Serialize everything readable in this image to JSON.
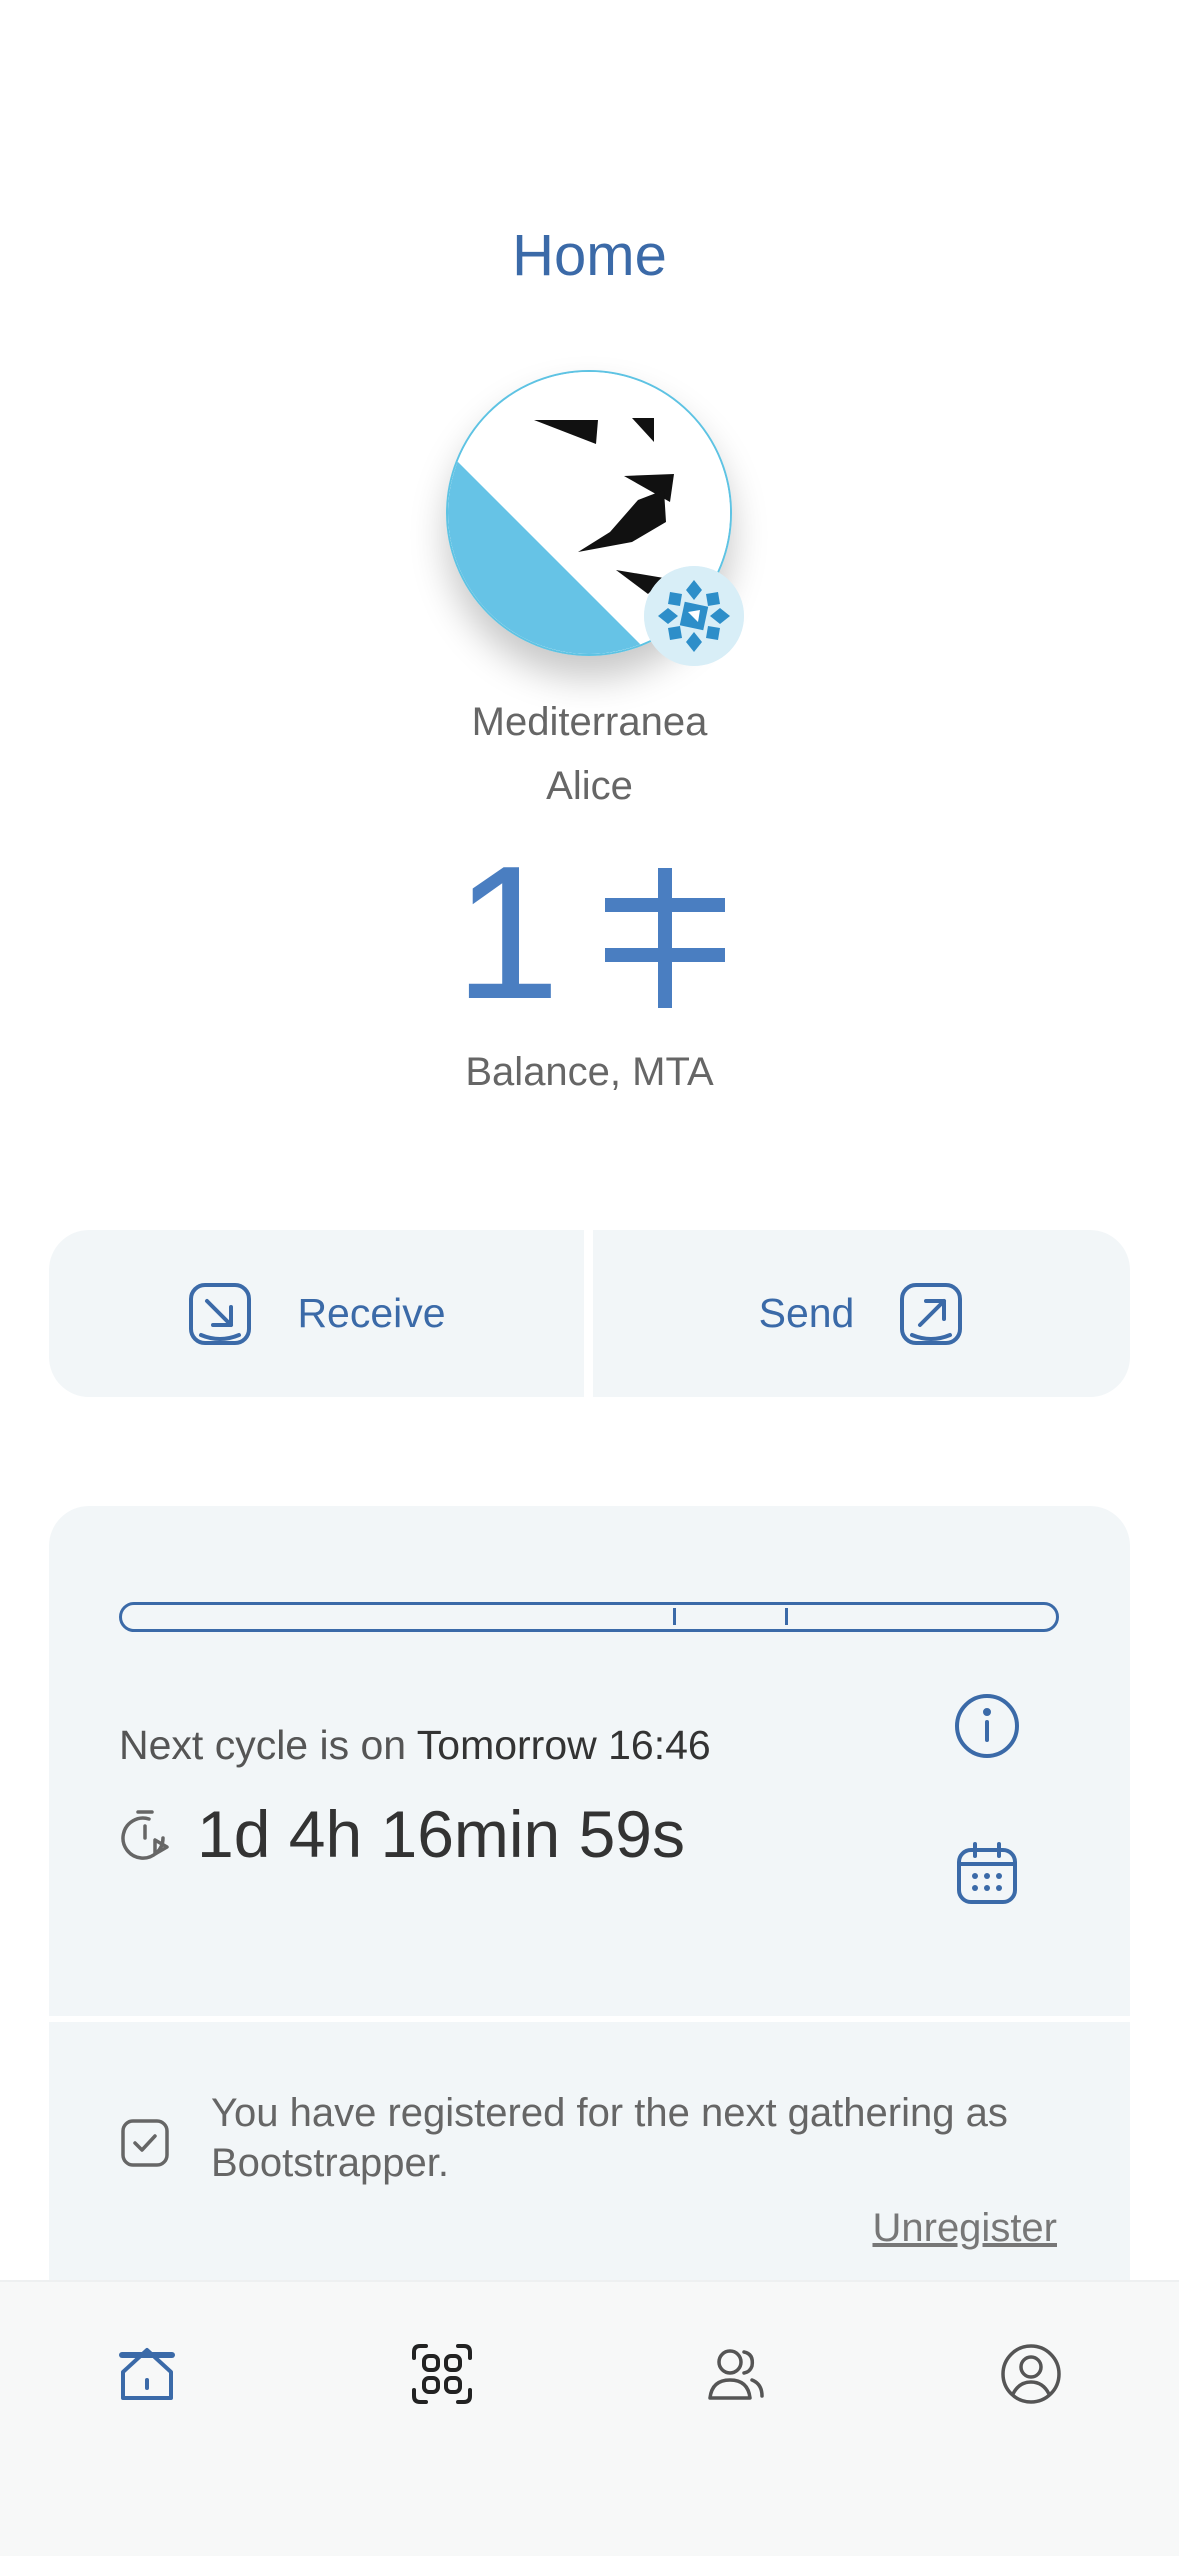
{
  "header": {
    "title": "Home"
  },
  "community": {
    "name": "Mediterranea",
    "user": "Alice"
  },
  "balance": {
    "value": "1",
    "label": "Balance, MTA"
  },
  "actions": {
    "receive_label": "Receive",
    "send_label": "Send"
  },
  "cycle": {
    "prefix": "Next cycle is on",
    "when": "Tomorrow 16:46",
    "countdown": "1d 4h 16min 59s",
    "progress_ticks": [
      0.59,
      0.71
    ]
  },
  "registration": {
    "message": "You have registered for the next gathering as Bootstrapper.",
    "unregister_label": "Unregister"
  },
  "nav": {
    "items": [
      "home-icon",
      "scan-icon",
      "contacts-icon",
      "profile-icon"
    ],
    "active": "home-icon"
  },
  "colors": {
    "accent": "#3b6aa8",
    "balance": "#4a7ec1",
    "card_bg": "#f2f6f8",
    "avatar_blue": "#66c3e6"
  }
}
